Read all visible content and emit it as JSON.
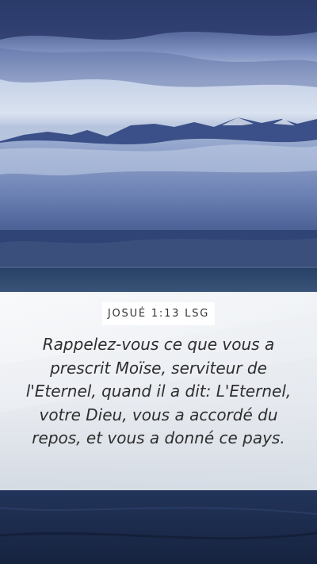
{
  "reference": "JOSUÉ 1:13 LSG",
  "verse_text": "Rappelez-vous ce que vous a prescrit Moïse, serviteur de l'Eternel, quand il a dit: L'Eternel, votre Dieu, vous a accordé du repos, et vous a donné ce pays.",
  "colors": {
    "sky_top": "#2f3f6e",
    "cloud": "#cfd9ea",
    "mountain": "#3a4f86",
    "sea": "#2c4466",
    "sand": "#1a2a4c",
    "panel": "#ffffff",
    "text": "#2e2e2e"
  }
}
